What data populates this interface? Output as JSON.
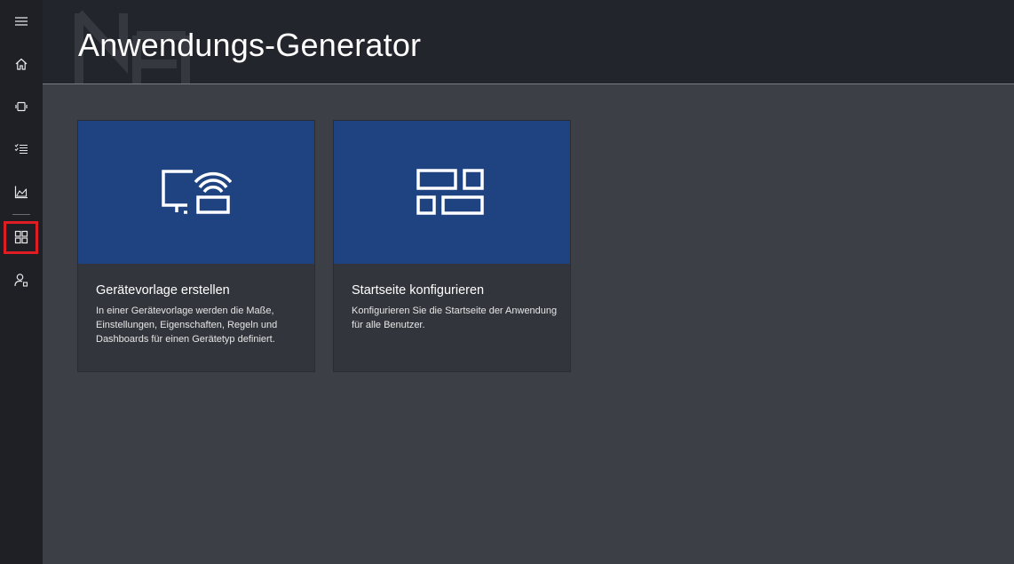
{
  "header": {
    "title": "Anwendungs-Generator",
    "watermark_icon": "ne-logo-watermark"
  },
  "rail": {
    "items": [
      {
        "name": "menu",
        "icon": "hamburger-icon"
      },
      {
        "name": "home",
        "icon": "home-icon"
      },
      {
        "name": "devices",
        "icon": "device-icon"
      },
      {
        "name": "rules",
        "icon": "checklist-icon"
      },
      {
        "name": "analytics",
        "icon": "analytics-icon"
      },
      {
        "name": "app-builder",
        "icon": "grid-icon",
        "active": true
      },
      {
        "name": "administration",
        "icon": "admin-user-icon"
      }
    ],
    "highlight_color": "#e11d24"
  },
  "tiles": [
    {
      "title": "Gerätevorlage erstellen",
      "description": "In einer Gerätevorlage werden die Maße, Einstellungen, Eigenschaften, Regeln und Dashboards für einen Gerätetyp definiert.",
      "icon": "device-template-icon"
    },
    {
      "title": "Startseite konfigurieren",
      "description": "Konfigurieren Sie die Startseite der Anwendung für alle Benutzer.",
      "icon": "dashboard-layout-icon"
    }
  ],
  "colors": {
    "tile_art": "#1e4380",
    "background": "#3d3f47",
    "rail": "#1f2026",
    "header": "#23252c"
  }
}
